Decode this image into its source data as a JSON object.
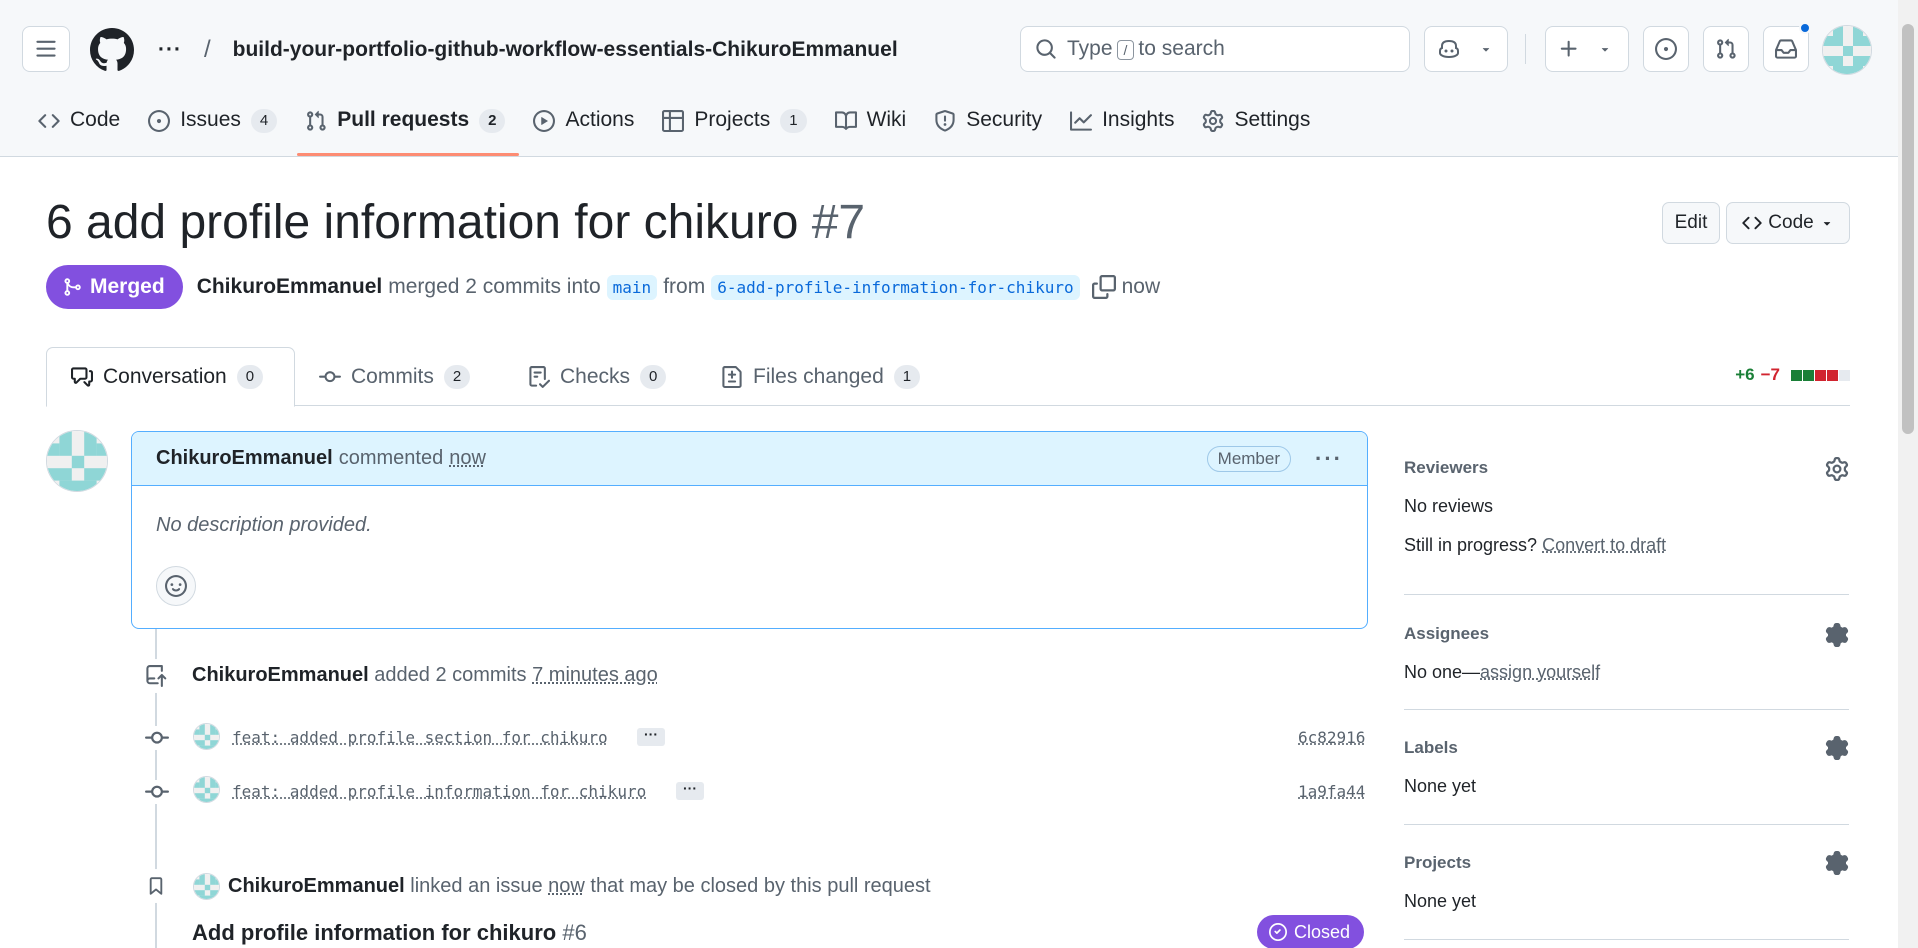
{
  "header": {
    "repo_ellipsis": "···",
    "repo_slash": "/",
    "repo_name": "build-your-portfolio-github-workflow-essentials-ChikuroEmmanuel",
    "search_prefix": "Type",
    "search_key": "/",
    "search_suffix": "to search"
  },
  "repo_nav": [
    {
      "label": "Code",
      "icon": "code-icon"
    },
    {
      "label": "Issues",
      "count": "4",
      "icon": "issue-icon"
    },
    {
      "label": "Pull requests",
      "count": "2",
      "icon": "pull-request-icon",
      "active": true
    },
    {
      "label": "Actions",
      "icon": "play-icon"
    },
    {
      "label": "Projects",
      "count": "1",
      "icon": "table-icon"
    },
    {
      "label": "Wiki",
      "icon": "book-icon"
    },
    {
      "label": "Security",
      "icon": "shield-icon"
    },
    {
      "label": "Insights",
      "icon": "graph-icon"
    },
    {
      "label": "Settings",
      "icon": "gear-icon"
    }
  ],
  "pr": {
    "title": "6 add profile information for chikuro",
    "number": "#7",
    "edit_label": "Edit",
    "code_label": "Code",
    "state": "Merged",
    "author": "ChikuroEmmanuel",
    "merged_text": "merged 2 commits into",
    "base_branch": "main",
    "from_text": "from",
    "head_branch": "6-add-profile-information-for-chikuro",
    "time": "now"
  },
  "pr_tabs": [
    {
      "label": "Conversation",
      "count": "0",
      "icon": "comment-discussion-icon",
      "active": true
    },
    {
      "label": "Commits",
      "count": "2",
      "icon": "commit-icon"
    },
    {
      "label": "Checks",
      "count": "0",
      "icon": "checklist-icon"
    },
    {
      "label": "Files changed",
      "count": "1",
      "icon": "file-diff-icon"
    }
  ],
  "diffstat": {
    "additions": "+6",
    "deletions": "−7",
    "blocks": [
      "add",
      "add",
      "del",
      "del",
      "neutral"
    ]
  },
  "comment": {
    "author": "ChikuroEmmanuel",
    "action": "commented",
    "time": "now",
    "role": "Member",
    "body": "No description provided."
  },
  "timeline": {
    "added_author": "ChikuroEmmanuel",
    "added_text": "added 2 commits",
    "added_time": "7 minutes ago",
    "commits": [
      {
        "message": "feat: added profile section for chikuro",
        "sha": "6c82916"
      },
      {
        "message": "feat: added profile information for chikuro",
        "sha": "1a9fa44"
      }
    ],
    "ellipsis": "···",
    "linked_author": "ChikuroEmmanuel",
    "linked_text": "linked an issue",
    "linked_time": "now",
    "linked_suffix": "that may be closed by this pull request",
    "issue_title": "Add profile information for chikuro",
    "issue_number": "#6",
    "issue_state": "Closed"
  },
  "sidebar": {
    "reviewers": {
      "heading": "Reviewers",
      "value": "No reviews",
      "draft_prefix": "Still in progress?",
      "draft_link": "Convert to draft"
    },
    "assignees": {
      "heading": "Assignees",
      "value": "No one—",
      "link": "assign yourself"
    },
    "labels": {
      "heading": "Labels",
      "value": "None yet"
    },
    "projects": {
      "heading": "Projects",
      "value": "None yet"
    }
  },
  "colors": {
    "merged": "#8250df",
    "accent": "#0969da",
    "additions": "#1a7f37",
    "deletions": "#d1242f",
    "tab_underline": "#fd8c73",
    "notification": "#0969da"
  }
}
